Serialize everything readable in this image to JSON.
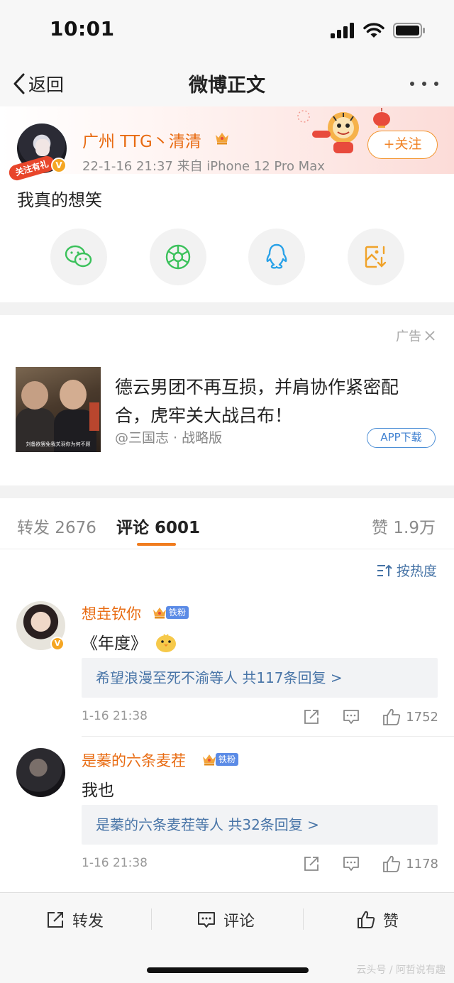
{
  "status_bar": {
    "time": "10:01"
  },
  "nav": {
    "back_label": "返回",
    "title": "微博正文"
  },
  "post": {
    "author": "广州 TTG丶清清",
    "avatar_ribbon": "关注有礼",
    "meta": "22-1-16 21:37  来自 iPhone 12 Pro Max",
    "follow_label": "+关注",
    "text": "我真的想笑",
    "share_targets": [
      "wechat-icon",
      "moments-icon",
      "qq-icon",
      "save-image-icon"
    ]
  },
  "ad": {
    "tag": "广告",
    "image_caption": "刘备欲罢免我关羽你为何不顾",
    "title": "德云男团不再互损，并肩协作紧密配合，虎牢关大战吕布！",
    "source": "@三国志 · 战略版",
    "download_label": "APP下载"
  },
  "tabs": {
    "repost": "转发 2676",
    "comment": "评论 6001",
    "like": "赞 1.9万"
  },
  "sort_label": "按热度",
  "comments": [
    {
      "name": "想垚钦你",
      "fan_tag": "铁粉",
      "text": "《年度》",
      "replies": "希望浪漫至死不渝等人  共117条回复 >",
      "time": "1-16 21:38",
      "likes": "1752"
    },
    {
      "name": "是蓁的六条麦茬",
      "fan_tag": "铁粉",
      "text": "我也",
      "replies": "是蓁的六条麦茬等人  共32条回复 >",
      "time": "1-16 21:38",
      "likes": "1178"
    }
  ],
  "bottom_bar": {
    "repost": "转发",
    "comment": "评论",
    "like": "赞"
  },
  "watermark": "云头号 / 阿哲说有趣",
  "colors": {
    "accent": "#e86b12",
    "link": "#4a76a8",
    "tab_underline": "#f07c1e"
  }
}
